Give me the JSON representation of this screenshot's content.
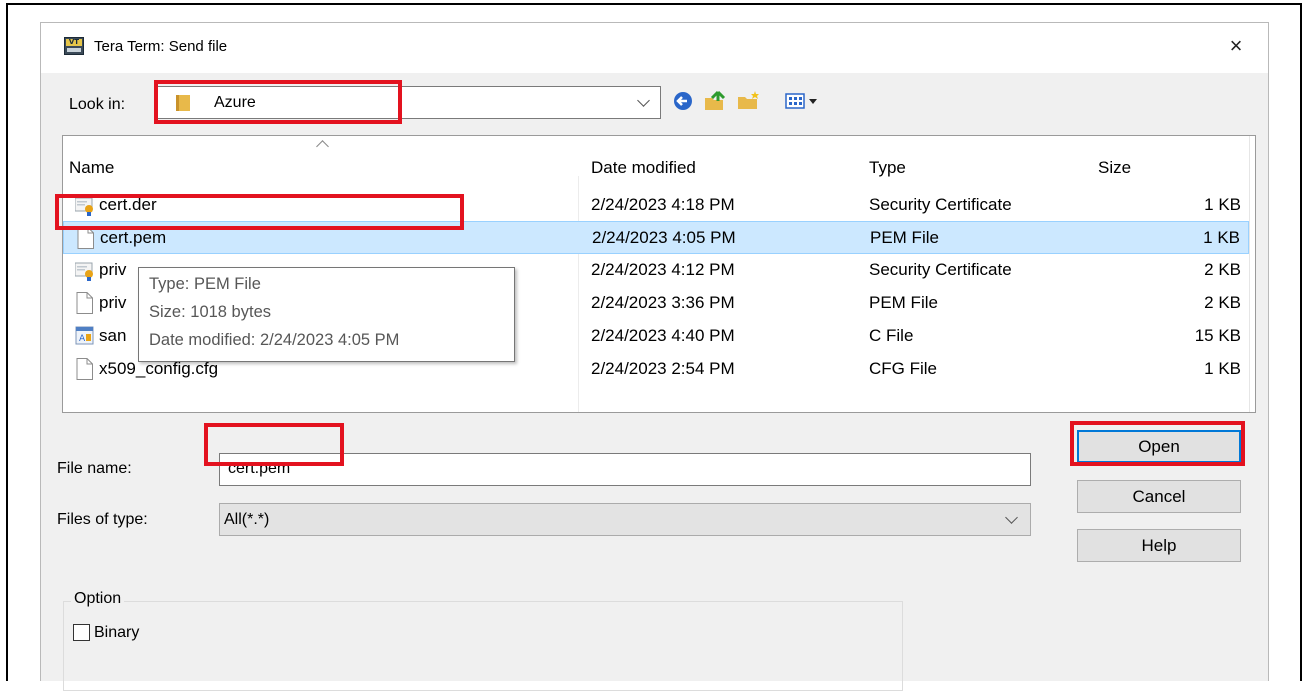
{
  "window": {
    "title": "Tera Term: Send file",
    "app_icon_text": "VT",
    "close_glyph": "×"
  },
  "lookin": {
    "label": "Look in:",
    "value": "Azure"
  },
  "toolbar": {
    "icons": [
      "back-icon",
      "up-folder-icon",
      "new-folder-icon",
      "view-menu-icon"
    ]
  },
  "filelist": {
    "columns": {
      "name": "Name",
      "date": "Date modified",
      "type": "Type",
      "size": "Size"
    },
    "rows": [
      {
        "name": "cert.der",
        "date": "2/24/2023 4:18 PM",
        "type": "Security Certificate",
        "size": "1 KB",
        "icon": "certificate-icon"
      },
      {
        "name": "cert.pem",
        "date": "2/24/2023 4:05 PM",
        "type": "PEM File",
        "size": "1 KB",
        "icon": "file-icon"
      },
      {
        "name": "priv",
        "date": "2/24/2023 4:12 PM",
        "type": "Security Certificate",
        "size": "2 KB",
        "icon": "certificate-icon"
      },
      {
        "name": "priv",
        "date": "2/24/2023 3:36 PM",
        "type": "PEM File",
        "size": "2 KB",
        "icon": "file-icon"
      },
      {
        "name": "san",
        "date": "2/24/2023 4:40 PM",
        "type": "C File",
        "size": "15 KB",
        "icon": "c-source-icon"
      },
      {
        "name": "x509_config.cfg",
        "date": "2/24/2023 2:54 PM",
        "type": "CFG File",
        "size": "1 KB",
        "icon": "file-icon"
      }
    ],
    "selected_index": 1
  },
  "tooltip": {
    "type": "Type: PEM File",
    "size": "Size: 1018 bytes",
    "date": "Date modified: 2/24/2023 4:05 PM"
  },
  "filename": {
    "label": "File name:",
    "value": "cert.pem"
  },
  "filetype": {
    "label": "Files of type:",
    "value": "All(*.*)"
  },
  "buttons": {
    "open": "Open",
    "cancel": "Cancel",
    "help": "Help"
  },
  "option": {
    "group_label": "Option",
    "binary_label": "Binary",
    "binary_checked": false
  },
  "colors": {
    "highlight": "#e3121f",
    "selection": "#cce8ff",
    "default_button_border": "#0078d7"
  }
}
